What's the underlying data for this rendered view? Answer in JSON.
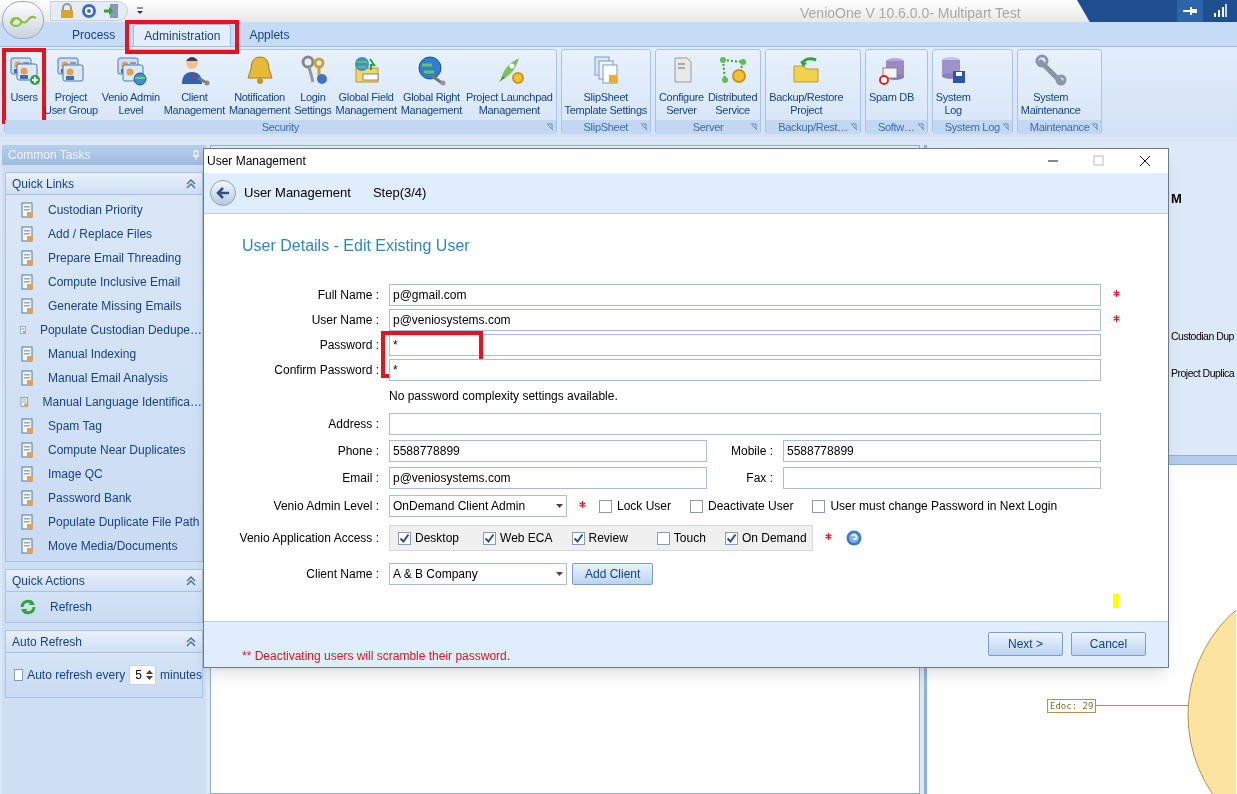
{
  "app": {
    "title": "VenioOne V 10.6.0.0- Multipart Test"
  },
  "tabs": [
    {
      "label": "Process",
      "selected": false,
      "highlighted": false
    },
    {
      "label": "Administration",
      "selected": true,
      "highlighted": true
    },
    {
      "label": "Applets",
      "selected": false,
      "highlighted": false
    }
  ],
  "ribbon_groups": [
    {
      "name": "Security",
      "buttons": [
        {
          "lines": [
            "Users"
          ],
          "highlighted": true
        },
        {
          "lines": [
            "Project",
            "User Group"
          ],
          "highlighted": false
        },
        {
          "lines": [
            "Venio Admin",
            "Level"
          ],
          "highlighted": false
        },
        {
          "lines": [
            "Client",
            "Management"
          ],
          "highlighted": false
        },
        {
          "lines": [
            "Notification",
            "Management"
          ],
          "highlighted": false
        },
        {
          "lines": [
            "Login",
            "Settings"
          ],
          "highlighted": false
        },
        {
          "lines": [
            "Global Field",
            "Management"
          ],
          "highlighted": false
        },
        {
          "lines": [
            "Global Right",
            "Management"
          ],
          "highlighted": false
        },
        {
          "lines": [
            "Project Launchpad",
            "Management"
          ],
          "highlighted": false
        }
      ]
    },
    {
      "name": "SlipSheet",
      "buttons": [
        {
          "lines": [
            "SlipSheet",
            "Template Settings"
          ],
          "highlighted": false
        }
      ]
    },
    {
      "name": "Server",
      "buttons": [
        {
          "lines": [
            "Configure",
            "Server"
          ],
          "highlighted": false
        },
        {
          "lines": [
            "Distributed",
            "Service"
          ],
          "highlighted": false
        }
      ]
    },
    {
      "name": "Backup/Rest…",
      "buttons": [
        {
          "lines": [
            "Backup/Restore",
            "Project"
          ],
          "highlighted": false
        }
      ]
    },
    {
      "name": "Softw…",
      "buttons": [
        {
          "lines": [
            "Spam DB"
          ],
          "highlighted": false
        }
      ]
    },
    {
      "name": "System Log",
      "buttons": [
        {
          "lines": [
            "System",
            "Log"
          ],
          "highlighted": false
        }
      ]
    },
    {
      "name": "Maintenance",
      "buttons": [
        {
          "lines": [
            "System",
            "Maintenance"
          ],
          "highlighted": false
        }
      ]
    }
  ],
  "side_panel": {
    "title": "Common Tasks",
    "sections": [
      {
        "title": "Quick Links",
        "items": [
          "Custodian Priority",
          "Add / Replace Files",
          "Prepare Email Threading",
          "Compute Inclusive Email",
          "Generate Missing Emails",
          "Populate Custodian Dedupe…",
          "Manual Indexing",
          "Manual Email Analysis",
          "Manual Language Identifica…",
          "Spam Tag",
          "Compute Near Duplicates",
          "Image QC",
          "Password Bank",
          "Populate Duplicate File Path",
          "Move Media/Documents"
        ]
      },
      {
        "title": "Quick Actions",
        "items": [
          "Refresh"
        ]
      },
      {
        "title": "Auto Refresh",
        "auto_refresh": {
          "label": "Auto refresh every",
          "checked": false,
          "value": "5",
          "unit": "minutes"
        }
      }
    ]
  },
  "background": {
    "texts": [
      "M",
      "Custodian Dup",
      "Project Duplica"
    ],
    "node_label": "Edoc: 29"
  },
  "dialog": {
    "title": "User Management",
    "header": "User Management",
    "step": "Step(3/4)",
    "heading": "User Details - Edit Existing User",
    "password_fields_highlighted": true,
    "fields": [
      {
        "label": "Full Name :",
        "value": "p@gmail.com",
        "required": true
      },
      {
        "label": "User Name :",
        "value": "p@veniosystems.com",
        "required": true
      },
      {
        "label": "Password :",
        "value": "*",
        "required": false
      },
      {
        "label": "Confirm Password :",
        "value": "*",
        "required": false
      }
    ],
    "password_note": "No password complexity settings available.",
    "address": {
      "label": "Address :"
    },
    "phone": {
      "label": "Phone :",
      "value": "5588778899"
    },
    "mobile": {
      "label": "Mobile :",
      "value": "5588778899"
    },
    "email": {
      "label": "Email :",
      "value": "p@veniosystems.com"
    },
    "fax": {
      "label": "Fax :"
    },
    "admin_level": {
      "label": "Venio Admin Level :",
      "value": "OnDemand Client Admin",
      "required": true
    },
    "user_flags": [
      {
        "label": "Lock User",
        "checked": false
      },
      {
        "label": "Deactivate User",
        "checked": false
      },
      {
        "label": "User must change Password in Next Login",
        "checked": false
      }
    ],
    "app_access": {
      "label": "Venio Application Access :",
      "required": true,
      "options": [
        {
          "label": "Desktop",
          "checked": true
        },
        {
          "label": "Web ECA",
          "checked": true
        },
        {
          "label": "Review",
          "checked": true
        },
        {
          "label": "Touch",
          "checked": false
        },
        {
          "label": "On Demand",
          "checked": true
        }
      ]
    },
    "client": {
      "label": "Client Name :",
      "value": "A & B Company",
      "button": "Add Client"
    },
    "footer_note_mark": "**",
    "footer_note": "Deactivating users will scramble their password.",
    "buttons": [
      "Next >",
      "Cancel"
    ]
  }
}
